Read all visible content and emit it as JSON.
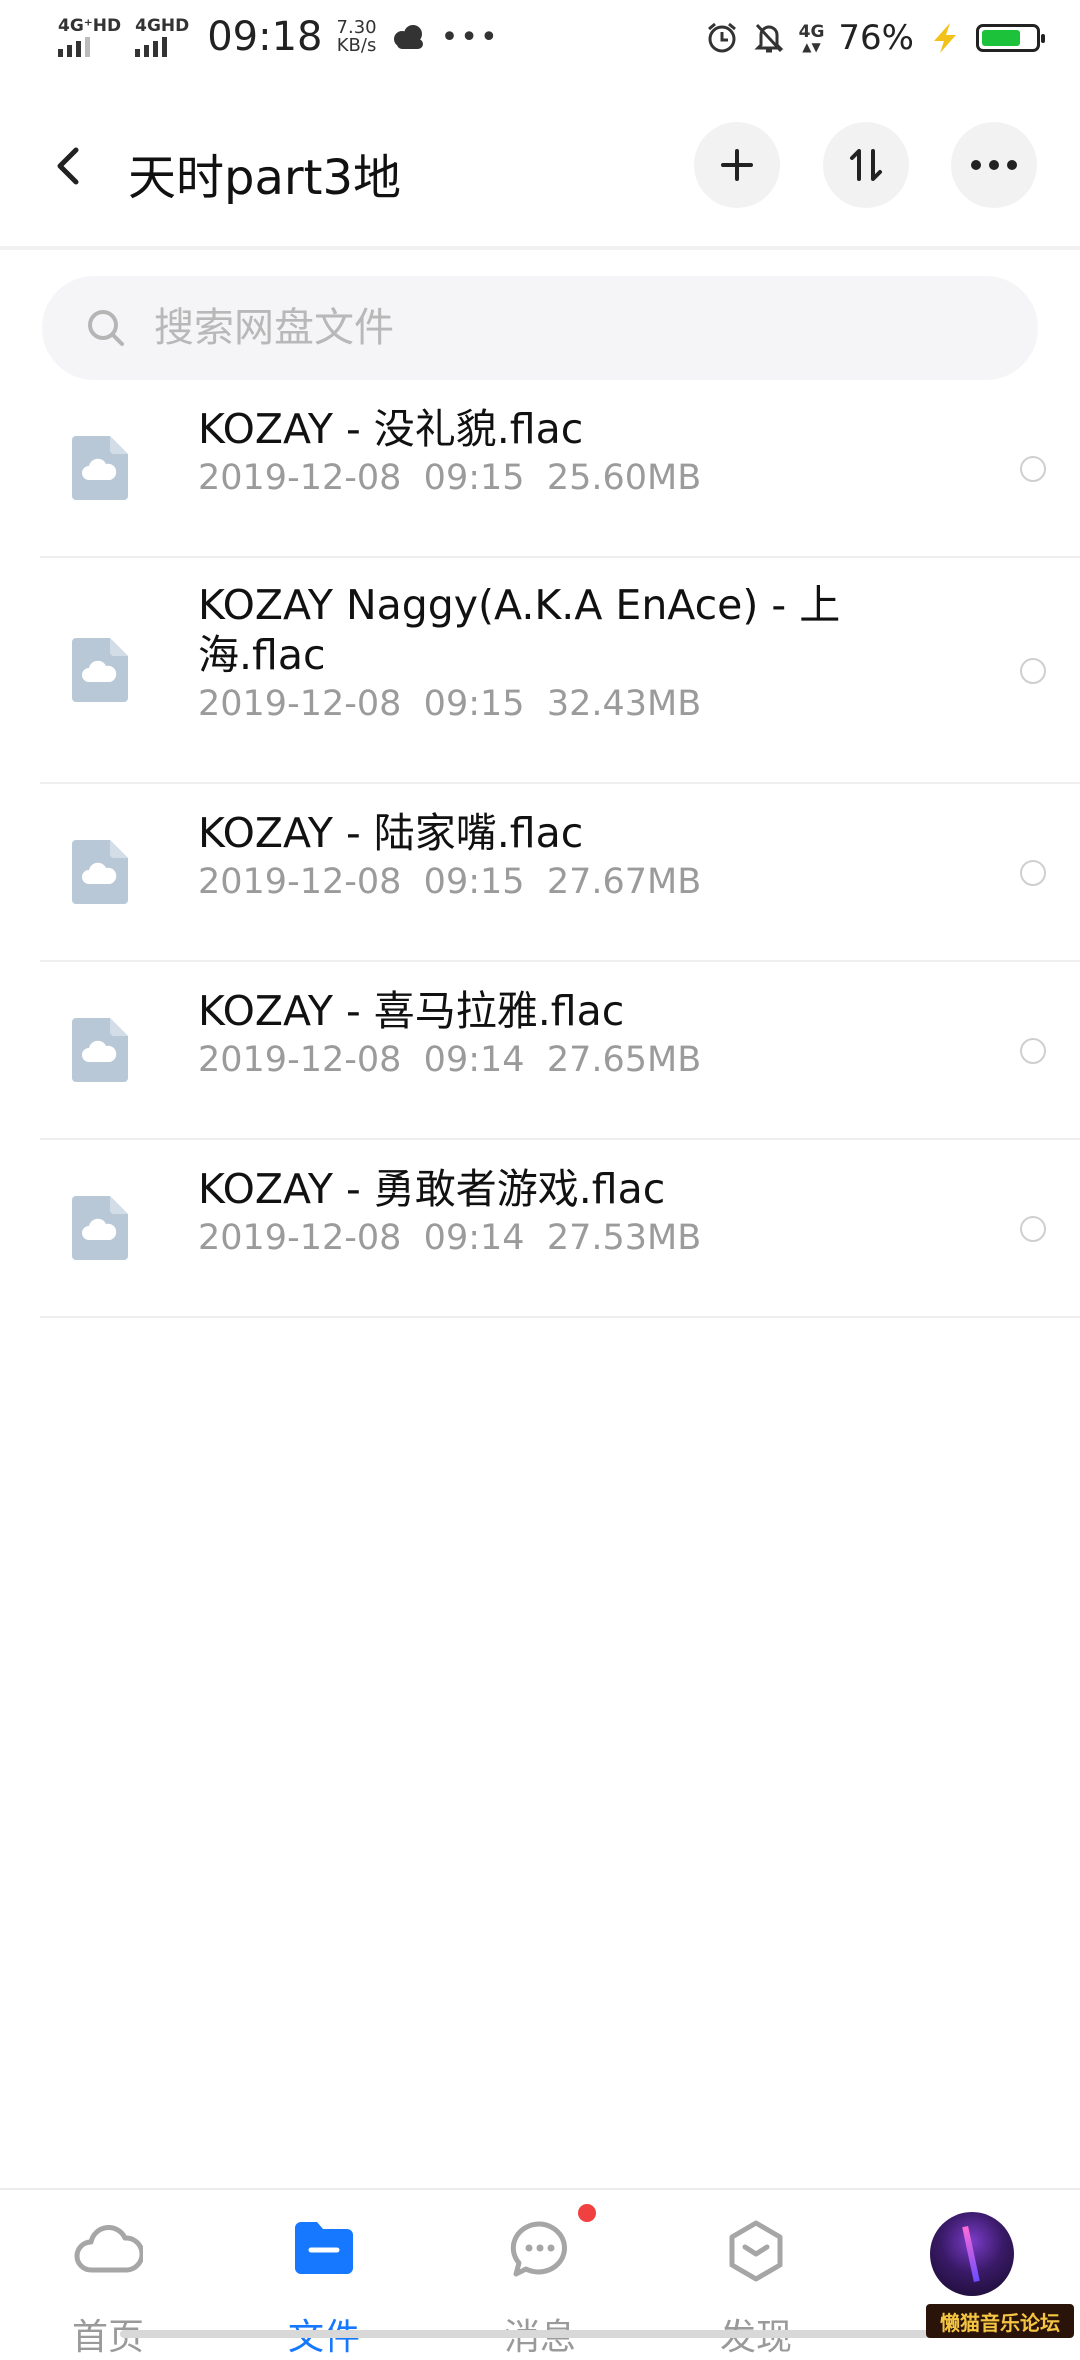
{
  "status_bar": {
    "net1": "4G⁺HD",
    "net2": "4GHD",
    "time": "09:18",
    "speed_value": "7.30",
    "speed_unit": "KB/s",
    "lte": "4G",
    "battery_text": "76%",
    "battery_level": 0.76,
    "icons": [
      "signal-icon",
      "weather-cloud-icon",
      "more-dots-icon",
      "alarm-icon",
      "bell-muted-icon",
      "lte-icon",
      "charging-bolt-icon",
      "battery-icon"
    ]
  },
  "header": {
    "title": "天时part3地",
    "buttons": [
      "add-icon",
      "sort-icon",
      "more-icon"
    ]
  },
  "search": {
    "placeholder": "搜索网盘文件"
  },
  "files": [
    {
      "name": "KOZAY - 没礼貌.flac",
      "date": "2019-12-08",
      "time": "09:15",
      "size": "25.60MB"
    },
    {
      "name": "KOZAY Naggy(A.K.A EnAce) - 上海.flac",
      "date": "2019-12-08",
      "time": "09:15",
      "size": "32.43MB"
    },
    {
      "name": "KOZAY - 陆家嘴.flac",
      "date": "2019-12-08",
      "time": "09:15",
      "size": "27.67MB"
    },
    {
      "name": "KOZAY - 喜马拉雅.flac",
      "date": "2019-12-08",
      "time": "09:14",
      "size": "27.65MB"
    },
    {
      "name": "KOZAY - 勇敢者游戏.flac",
      "date": "2019-12-08",
      "time": "09:14",
      "size": "27.53MB"
    }
  ],
  "bottom_nav": {
    "home": "首页",
    "files": "文件",
    "messages": "消息",
    "discover": "发现",
    "active": "files"
  },
  "watermark": "懒猫音乐论坛",
  "colors": {
    "accent": "#1677ff",
    "file_icon": "#b9c8d6",
    "badge": "#f04040",
    "battery": "#1bc23a"
  }
}
